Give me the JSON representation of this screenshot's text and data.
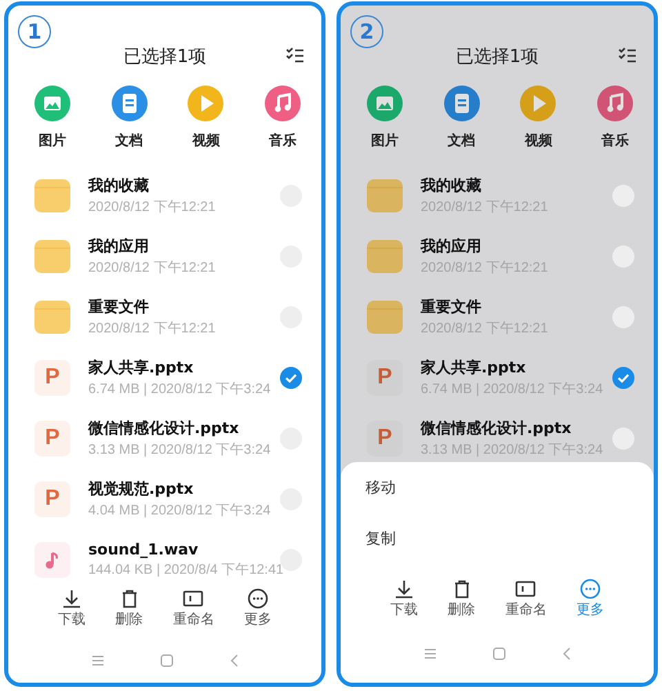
{
  "panels": [
    {
      "badge": "1",
      "title": "已选择1项",
      "categories": [
        {
          "label": "图片",
          "kind": "image"
        },
        {
          "label": "文档",
          "kind": "doc"
        },
        {
          "label": "视频",
          "kind": "video"
        },
        {
          "label": "音乐",
          "kind": "music"
        }
      ],
      "files": [
        {
          "name": "我的收藏",
          "meta": "2020/8/12 下午12:21",
          "kind": "folder",
          "selected": false
        },
        {
          "name": "我的应用",
          "meta": "2020/8/12 下午12:21",
          "kind": "folder",
          "selected": false
        },
        {
          "name": "重要文件",
          "meta": "2020/8/12 下午12:21",
          "kind": "folder",
          "selected": false
        },
        {
          "name": "家人共享.pptx",
          "meta": "6.74 MB | 2020/8/12 下午3:24",
          "kind": "ppt",
          "letter": "P",
          "selected": true
        },
        {
          "name": "微信情感化设计.pptx",
          "meta": "3.13 MB | 2020/8/12 下午3:24",
          "kind": "ppt",
          "letter": "P",
          "selected": false
        },
        {
          "name": "视觉规范.pptx",
          "meta": "4.04 MB | 2020/8/12 下午3:24",
          "kind": "ppt",
          "letter": "P",
          "selected": false
        },
        {
          "name": "sound_1.wav",
          "meta": "144.04 KB | 2020/8/4 下午12:41",
          "kind": "audio",
          "selected": false
        }
      ],
      "toolbar": [
        {
          "label": "下载",
          "kind": "download",
          "selected": false
        },
        {
          "label": "删除",
          "kind": "delete",
          "selected": false
        },
        {
          "label": "重命名",
          "kind": "rename",
          "selected": false
        },
        {
          "label": "更多",
          "kind": "more",
          "selected": false
        }
      ]
    },
    {
      "badge": "2",
      "title": "已选择1项",
      "categories": [
        {
          "label": "图片",
          "kind": "image"
        },
        {
          "label": "文档",
          "kind": "doc"
        },
        {
          "label": "视频",
          "kind": "video"
        },
        {
          "label": "音乐",
          "kind": "music"
        }
      ],
      "files": [
        {
          "name": "我的收藏",
          "meta": "2020/8/12 下午12:21",
          "kind": "folder",
          "selected": false
        },
        {
          "name": "我的应用",
          "meta": "2020/8/12 下午12:21",
          "kind": "folder",
          "selected": false
        },
        {
          "name": "重要文件",
          "meta": "2020/8/12 下午12:21",
          "kind": "folder",
          "selected": false
        },
        {
          "name": "家人共享.pptx",
          "meta": "6.74 MB | 2020/8/12 下午3:24",
          "kind": "ppt",
          "letter": "P",
          "selected": true
        },
        {
          "name": "微信情感化设计.pptx",
          "meta": "3.13 MB | 2020/8/12 下午3:24",
          "kind": "ppt",
          "letter": "P",
          "selected": false
        }
      ],
      "sheet": {
        "items": [
          "移动",
          "复制"
        ]
      },
      "toolbar": [
        {
          "label": "下载",
          "kind": "download",
          "selected": false
        },
        {
          "label": "删除",
          "kind": "delete",
          "selected": false
        },
        {
          "label": "重命名",
          "kind": "rename",
          "selected": false
        },
        {
          "label": "更多",
          "kind": "more",
          "selected": true
        }
      ]
    }
  ]
}
